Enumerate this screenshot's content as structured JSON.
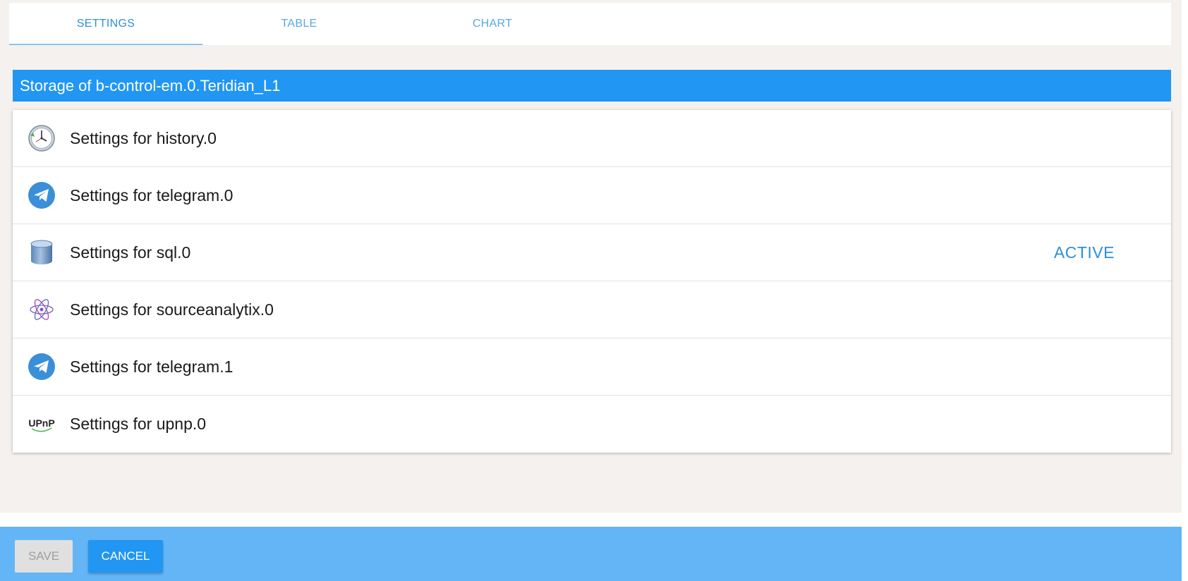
{
  "tabs": [
    {
      "label": "SETTINGS",
      "active": true
    },
    {
      "label": "TABLE",
      "active": false
    },
    {
      "label": "CHART",
      "active": false
    }
  ],
  "storage": {
    "title": "Storage of b-control-em.0.Teridian_L1"
  },
  "adapters": [
    {
      "label": "Settings for history.0",
      "icon": "history-clock-icon",
      "status": ""
    },
    {
      "label": "Settings for telegram.0",
      "icon": "telegram-icon",
      "status": ""
    },
    {
      "label": "Settings for sql.0",
      "icon": "database-icon",
      "status": "ACTIVE"
    },
    {
      "label": "Settings for sourceanalytix.0",
      "icon": "atom-icon",
      "status": ""
    },
    {
      "label": "Settings for telegram.1",
      "icon": "telegram-icon",
      "status": ""
    },
    {
      "label": "Settings for upnp.0",
      "icon": "upnp-logo-icon",
      "status": "",
      "logo_text": "UPnP"
    }
  ],
  "footer": {
    "save_label": "SAVE",
    "cancel_label": "CANCEL"
  },
  "colors": {
    "primary": "#2196f3",
    "footer": "#64b5f6",
    "active_text": "#2d8fdc"
  }
}
